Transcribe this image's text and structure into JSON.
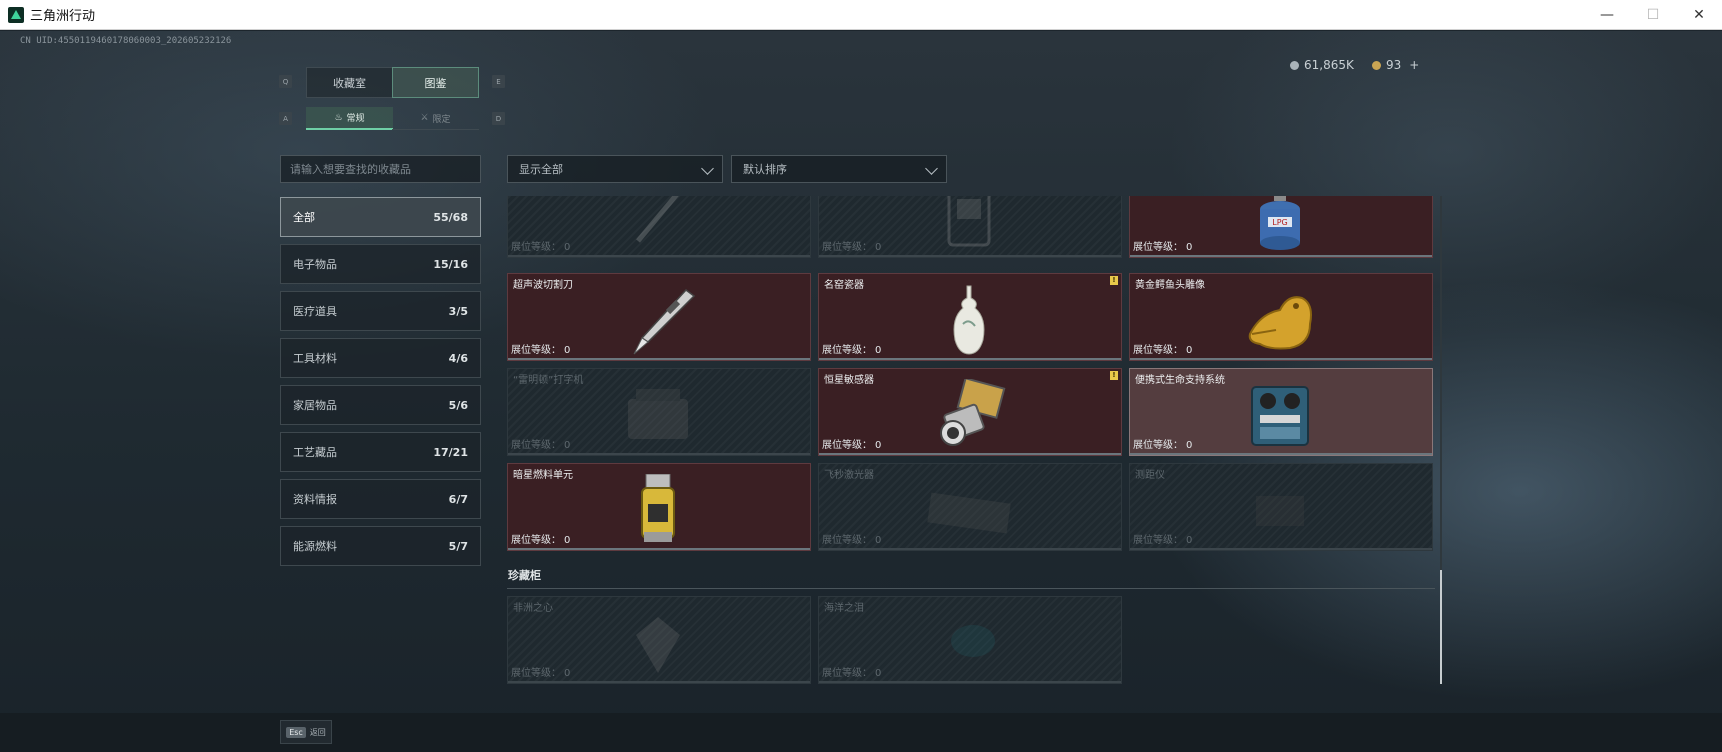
{
  "window": {
    "title": "三角洲行动",
    "controls": {
      "minimize": "—",
      "maximize": "☐",
      "close": "✕"
    }
  },
  "uid": "CN UID:4550119460178060003_202605232126",
  "currency": {
    "silver": "61,865K",
    "gold": "93",
    "gold_add": "+",
    "silver_color": "#a9b3b9",
    "gold_color": "#c9a553"
  },
  "tabs": {
    "key_left": "Q",
    "key_right": "E",
    "items": [
      {
        "label": "收藏室",
        "active": false
      },
      {
        "label": "图鉴",
        "active": true
      }
    ]
  },
  "subtabs": {
    "key_left": "A",
    "key_right": "D",
    "items": [
      {
        "label": "常规",
        "active": true
      },
      {
        "label": "限定",
        "active": false
      }
    ]
  },
  "search": {
    "placeholder": "请输入想要查找的收藏品"
  },
  "categories": [
    {
      "label": "全部",
      "count": "55/68",
      "active": true
    },
    {
      "label": "电子物品",
      "count": "15/16",
      "active": false
    },
    {
      "label": "医疗道具",
      "count": "3/5",
      "active": false
    },
    {
      "label": "工具材料",
      "count": "4/6",
      "active": false
    },
    {
      "label": "家居物品",
      "count": "5/6",
      "active": false
    },
    {
      "label": "工艺藏品",
      "count": "17/21",
      "active": false
    },
    {
      "label": "资料情报",
      "count": "6/7",
      "active": false
    },
    {
      "label": "能源燃料",
      "count": "5/7",
      "active": false
    }
  ],
  "filters": {
    "show": "显示全部",
    "sort": "默认排序"
  },
  "level_label": "展位等级：",
  "grid": {
    "rows": [
      [
        {
          "name": "",
          "level": "0",
          "state": "locked",
          "icon": "pen-icon",
          "badge": false
        },
        {
          "name": "",
          "level": "0",
          "state": "locked",
          "icon": "device-icon",
          "badge": false
        },
        {
          "name": "",
          "level": "0",
          "state": "owned",
          "icon": "gas-tank-icon",
          "badge": false
        }
      ],
      [
        {
          "name": "超声波切割刀",
          "level": "0",
          "state": "owned",
          "icon": "cutter-knife-icon",
          "badge": false
        },
        {
          "name": "名窑瓷器",
          "level": "0",
          "state": "owned",
          "icon": "porcelain-vase-icon",
          "badge": true
        },
        {
          "name": "黄金鳄鱼头雕像",
          "level": "0",
          "state": "owned",
          "icon": "gold-crocodile-icon",
          "badge": false
        }
      ],
      [
        {
          "name": "“雷明顿”打字机",
          "level": "0",
          "state": "locked",
          "icon": "typewriter-icon",
          "badge": false
        },
        {
          "name": "恒星敏感器",
          "level": "0",
          "state": "owned",
          "icon": "star-sensor-icon",
          "badge": true
        },
        {
          "name": "便携式生命支持系统",
          "level": "0",
          "state": "highlight",
          "icon": "life-support-icon",
          "badge": false
        }
      ],
      [
        {
          "name": "暗星燃料单元",
          "level": "0",
          "state": "owned",
          "icon": "fuel-cell-icon",
          "badge": false
        },
        {
          "name": "飞秒激光器",
          "level": "0",
          "state": "locked",
          "icon": "laser-icon",
          "badge": false
        },
        {
          "name": "测距仪",
          "level": "0",
          "state": "locked",
          "icon": "rangefinder-icon",
          "badge": false
        }
      ]
    ]
  },
  "section": {
    "title": "珍藏柜",
    "items": [
      {
        "name": "非洲之心",
        "level": "0",
        "state": "locked",
        "icon": "diamond-icon"
      },
      {
        "name": "海洋之泪",
        "level": "0",
        "state": "locked",
        "icon": "gem-icon"
      }
    ]
  },
  "esc": {
    "key": "Esc",
    "label": "返回"
  }
}
